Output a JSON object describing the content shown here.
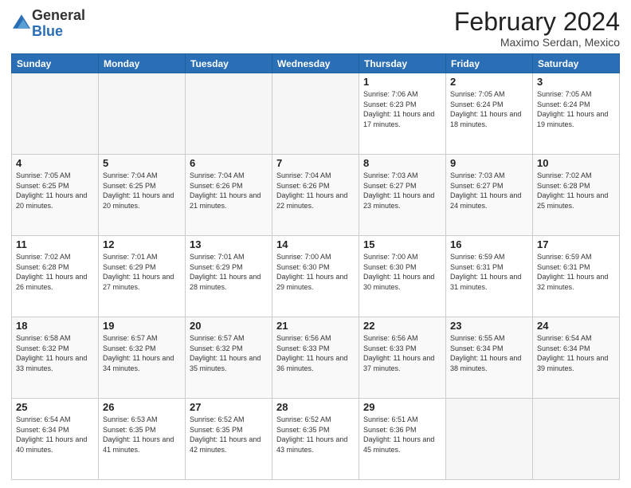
{
  "logo": {
    "general": "General",
    "blue": "Blue"
  },
  "title": "February 2024",
  "subtitle": "Maximo Serdan, Mexico",
  "days_of_week": [
    "Sunday",
    "Monday",
    "Tuesday",
    "Wednesday",
    "Thursday",
    "Friday",
    "Saturday"
  ],
  "weeks": [
    [
      {
        "day": "",
        "empty": true
      },
      {
        "day": "",
        "empty": true
      },
      {
        "day": "",
        "empty": true
      },
      {
        "day": "",
        "empty": true
      },
      {
        "day": "1",
        "sunrise": "7:06 AM",
        "sunset": "6:23 PM",
        "daylight": "11 hours and 17 minutes."
      },
      {
        "day": "2",
        "sunrise": "7:05 AM",
        "sunset": "6:24 PM",
        "daylight": "11 hours and 18 minutes."
      },
      {
        "day": "3",
        "sunrise": "7:05 AM",
        "sunset": "6:24 PM",
        "daylight": "11 hours and 19 minutes."
      }
    ],
    [
      {
        "day": "4",
        "sunrise": "7:05 AM",
        "sunset": "6:25 PM",
        "daylight": "11 hours and 20 minutes."
      },
      {
        "day": "5",
        "sunrise": "7:04 AM",
        "sunset": "6:25 PM",
        "daylight": "11 hours and 20 minutes."
      },
      {
        "day": "6",
        "sunrise": "7:04 AM",
        "sunset": "6:26 PM",
        "daylight": "11 hours and 21 minutes."
      },
      {
        "day": "7",
        "sunrise": "7:04 AM",
        "sunset": "6:26 PM",
        "daylight": "11 hours and 22 minutes."
      },
      {
        "day": "8",
        "sunrise": "7:03 AM",
        "sunset": "6:27 PM",
        "daylight": "11 hours and 23 minutes."
      },
      {
        "day": "9",
        "sunrise": "7:03 AM",
        "sunset": "6:27 PM",
        "daylight": "11 hours and 24 minutes."
      },
      {
        "day": "10",
        "sunrise": "7:02 AM",
        "sunset": "6:28 PM",
        "daylight": "11 hours and 25 minutes."
      }
    ],
    [
      {
        "day": "11",
        "sunrise": "7:02 AM",
        "sunset": "6:28 PM",
        "daylight": "11 hours and 26 minutes."
      },
      {
        "day": "12",
        "sunrise": "7:01 AM",
        "sunset": "6:29 PM",
        "daylight": "11 hours and 27 minutes."
      },
      {
        "day": "13",
        "sunrise": "7:01 AM",
        "sunset": "6:29 PM",
        "daylight": "11 hours and 28 minutes."
      },
      {
        "day": "14",
        "sunrise": "7:00 AM",
        "sunset": "6:30 PM",
        "daylight": "11 hours and 29 minutes."
      },
      {
        "day": "15",
        "sunrise": "7:00 AM",
        "sunset": "6:30 PM",
        "daylight": "11 hours and 30 minutes."
      },
      {
        "day": "16",
        "sunrise": "6:59 AM",
        "sunset": "6:31 PM",
        "daylight": "11 hours and 31 minutes."
      },
      {
        "day": "17",
        "sunrise": "6:59 AM",
        "sunset": "6:31 PM",
        "daylight": "11 hours and 32 minutes."
      }
    ],
    [
      {
        "day": "18",
        "sunrise": "6:58 AM",
        "sunset": "6:32 PM",
        "daylight": "11 hours and 33 minutes."
      },
      {
        "day": "19",
        "sunrise": "6:57 AM",
        "sunset": "6:32 PM",
        "daylight": "11 hours and 34 minutes."
      },
      {
        "day": "20",
        "sunrise": "6:57 AM",
        "sunset": "6:32 PM",
        "daylight": "11 hours and 35 minutes."
      },
      {
        "day": "21",
        "sunrise": "6:56 AM",
        "sunset": "6:33 PM",
        "daylight": "11 hours and 36 minutes."
      },
      {
        "day": "22",
        "sunrise": "6:56 AM",
        "sunset": "6:33 PM",
        "daylight": "11 hours and 37 minutes."
      },
      {
        "day": "23",
        "sunrise": "6:55 AM",
        "sunset": "6:34 PM",
        "daylight": "11 hours and 38 minutes."
      },
      {
        "day": "24",
        "sunrise": "6:54 AM",
        "sunset": "6:34 PM",
        "daylight": "11 hours and 39 minutes."
      }
    ],
    [
      {
        "day": "25",
        "sunrise": "6:54 AM",
        "sunset": "6:34 PM",
        "daylight": "11 hours and 40 minutes."
      },
      {
        "day": "26",
        "sunrise": "6:53 AM",
        "sunset": "6:35 PM",
        "daylight": "11 hours and 41 minutes."
      },
      {
        "day": "27",
        "sunrise": "6:52 AM",
        "sunset": "6:35 PM",
        "daylight": "11 hours and 42 minutes."
      },
      {
        "day": "28",
        "sunrise": "6:52 AM",
        "sunset": "6:35 PM",
        "daylight": "11 hours and 43 minutes."
      },
      {
        "day": "29",
        "sunrise": "6:51 AM",
        "sunset": "6:36 PM",
        "daylight": "11 hours and 45 minutes."
      },
      {
        "day": "",
        "empty": true
      },
      {
        "day": "",
        "empty": true
      }
    ]
  ]
}
